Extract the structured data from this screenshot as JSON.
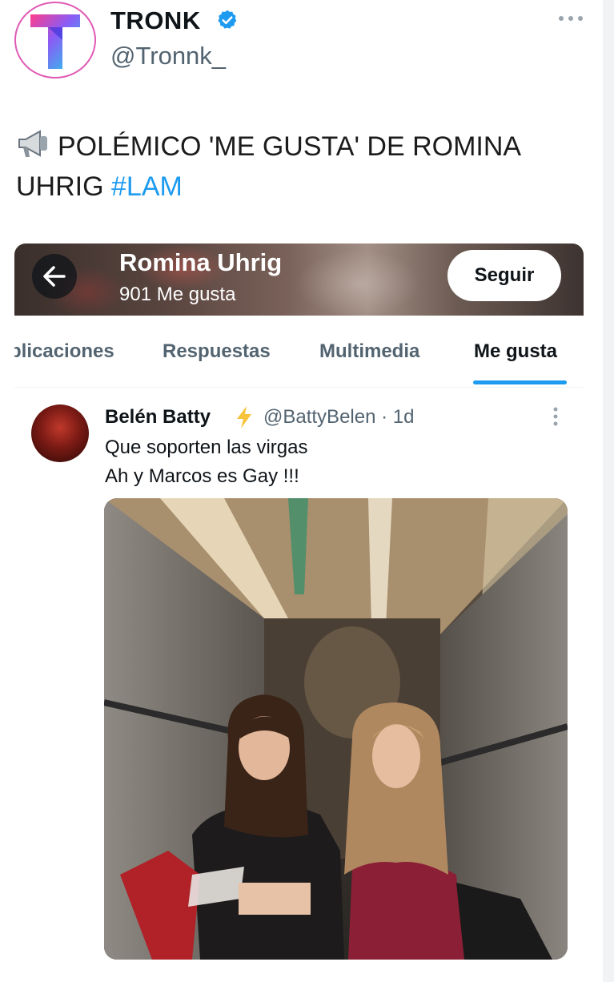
{
  "author": {
    "display_name": "TRONK",
    "handle": "@Tronnk_",
    "verified_icon": "verified-badge-icon",
    "logo_letter": "T"
  },
  "tweet": {
    "text_main": "POLÉMICO 'ME GUSTA' DE ROMINA UHRIG",
    "hashtag": "#LAM",
    "megaphone_icon": "megaphone-icon"
  },
  "embedded_profile": {
    "name": "Romina Uhrig",
    "likes_count": "901 Me gusta",
    "follow_label": "Seguir"
  },
  "tabs": [
    {
      "label": "blicaciones",
      "active": false
    },
    {
      "label": "Respuestas",
      "active": false
    },
    {
      "label": "Multimedia",
      "active": false
    },
    {
      "label": "Me gusta",
      "active": true
    }
  ],
  "liked_tweet": {
    "name": "Belén Batty",
    "handle_time": "@BattyBelen · 1d",
    "line1": "Que soporten las virgas",
    "line2": "Ah y Marcos es Gay !!!"
  },
  "colors": {
    "accent": "#1d9bf0",
    "text": "#0f1419",
    "secondary": "#536471",
    "bolt": "#f7c33a"
  }
}
